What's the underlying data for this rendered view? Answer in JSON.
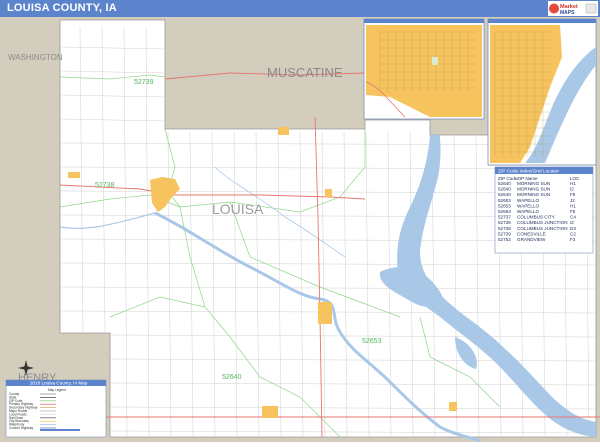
{
  "title": "LOUISA COUNTY, IA",
  "colors": {
    "header": "#5c84cc",
    "neighbor": "#d3cdbe",
    "county": "#ffffff",
    "urban": "#f6c35e",
    "water": "#a9c8e8",
    "zip_boundary": "#8fd58a",
    "highway": "#e8766e",
    "road": "#cfcfcf"
  },
  "logo": {
    "line1": "Market",
    "line2": "MAPS"
  },
  "neighbors": [
    {
      "name": "WASHINGTON"
    },
    {
      "name": "MUSCATINE"
    },
    {
      "name": "HENRY"
    }
  ],
  "county_label": "LOUISA",
  "zip_codes": [
    "52739",
    "52738",
    "52653",
    "52640"
  ],
  "zip_locator": {
    "title": "ZIP Code Index/Grid Locator",
    "headers": [
      "ZIP Code",
      "ZIP Name",
      "LOC"
    ],
    "rows": [
      [
        "52640",
        "MORNING SUN",
        "H1"
      ],
      [
        "52640",
        "MORNING SUN",
        "I2"
      ],
      [
        "52640",
        "MORNING SUN",
        "F8"
      ],
      [
        "52653",
        "WAPELLO",
        "J2"
      ],
      [
        "52653",
        "WAPELLO",
        "H1"
      ],
      [
        "52653",
        "WAPELLO",
        "F5"
      ],
      [
        "52737",
        "COLUMBUS CITY",
        "C4"
      ],
      [
        "52738",
        "COLUMBUS JUNCTION",
        "I2"
      ],
      [
        "52738",
        "COLUMBUS JUNCTION",
        "D3"
      ],
      [
        "52739",
        "CONESVILLE",
        "C2"
      ],
      [
        "52752",
        "GRANDVIEW",
        "F3"
      ]
    ]
  },
  "legend": {
    "title": "2018 Louisa County, IA Map",
    "subtitle": "Map Legend",
    "items": [
      "County",
      "State",
      "ZIP Code",
      "Primary Highway",
      "Secondary Highway",
      "Major Roads",
      "Local Roads",
      "Rail Road",
      "City Boundary",
      "Waterbody",
      "Custom Highway"
    ]
  }
}
